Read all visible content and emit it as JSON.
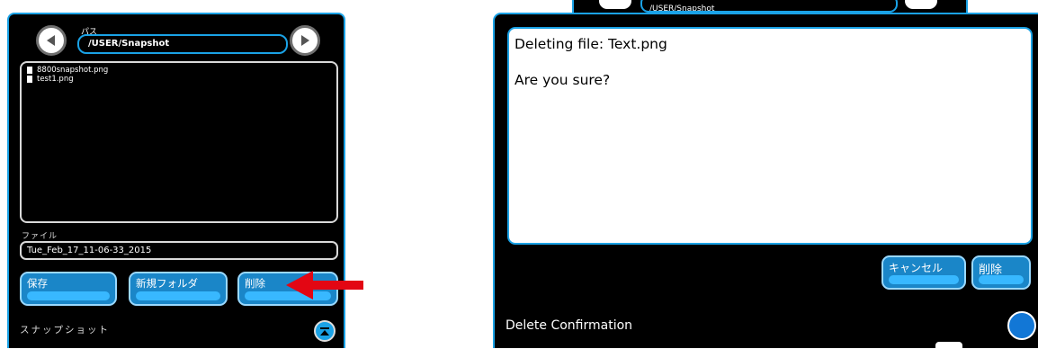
{
  "left": {
    "path_label": "パス",
    "path_value": "/USER/Snapshot",
    "back_icon": "left-arrow-icon",
    "forward_icon": "right-arrow-icon",
    "files": [
      "8800snapshot.png",
      "test1.png"
    ],
    "file_label": "ファイル",
    "file_value": "Tue_Feb_17_11-06-33_2015",
    "buttons": {
      "save": "保存",
      "new_folder": "新規フォルダ",
      "delete": "削除"
    },
    "title": "スナップショット",
    "scroll_icon": "scroll-up-icon",
    "arrow_color": "#e30613"
  },
  "right": {
    "bg_path": "/USER/Snapshot",
    "message_line1": "Deleting file: Text.png",
    "message_line2": "Are you sure?",
    "buttons": {
      "cancel": "キャンセル",
      "delete": "削除"
    },
    "title": "Delete Confirmation"
  },
  "colors": {
    "accent": "#1aa2e6",
    "button": "#1a86c8",
    "background": "#000000"
  }
}
